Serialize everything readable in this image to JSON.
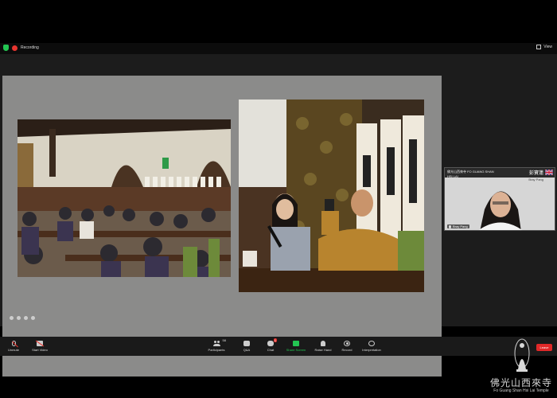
{
  "topbar": {
    "recording_label": "Recording",
    "view_label": "View"
  },
  "thumbnail": {
    "logo_text": "佛光山西來寺 FO GUANG SHAN HSI LAI",
    "name_cn": "彭寶蓮",
    "name_en": "Bray Pang",
    "label": "Bray Pang"
  },
  "toolbar": {
    "unmute": "Unmute",
    "start_video": "Start Video",
    "participants": "Participants",
    "participants_count": "58",
    "qa": "Q&A",
    "chat": "Chat",
    "chat_badge": "1",
    "share_screen": "Share Screen",
    "raise_hand": "Raise Hand",
    "record": "Record",
    "interpretation": "Interpretation",
    "leave": "Leave"
  },
  "watermark": {
    "name_cn": "佛光山西來寺",
    "name_en": "Fo Guang Shan Hsi Lai Temple"
  },
  "colors": {
    "accent_green": "#23c552",
    "leave_red": "#e02828",
    "slide_gray": "#8b8b8a"
  }
}
